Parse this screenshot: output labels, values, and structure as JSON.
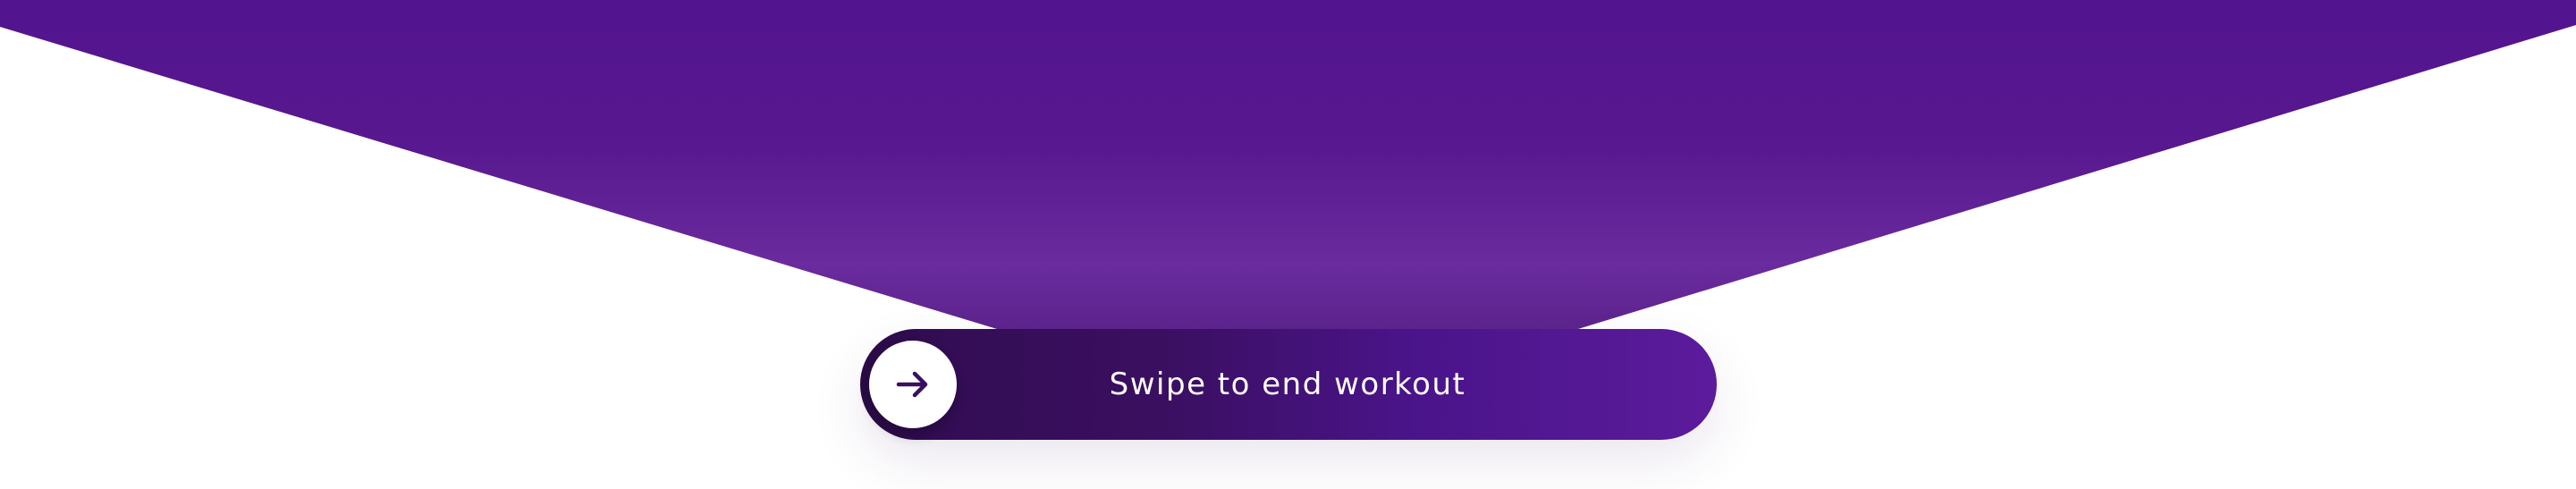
{
  "colors": {
    "header_top": "#52148f",
    "header_bottom": "#6a2b9e",
    "track_start": "#2a0b46",
    "track_end": "#5c1b9c",
    "handle": "#ffffff",
    "arrow": "#3a0f60"
  },
  "swipe": {
    "label": "Swipe to end workout",
    "handle_icon": "arrow-right-icon"
  }
}
